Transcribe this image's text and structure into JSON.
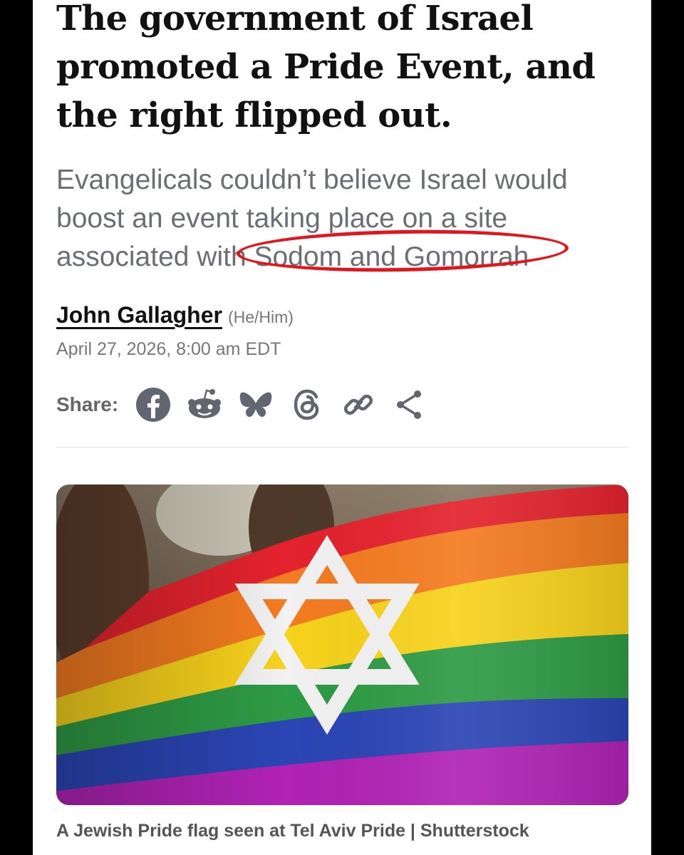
{
  "article": {
    "headline": "The government of Israel promoted a Pride Event, and the right flipped out.",
    "dek_before": "Evangelicals couldn’t believe Israel would boost an event taking place on a site associated with",
    "dek_highlight": "Sodom and Gomorrah",
    "author": "John Gallagher",
    "pronouns": "(He/Him)",
    "date": "April 27, 2026, 8:00 am EDT"
  },
  "share": {
    "label": "Share:",
    "icons": [
      "facebook-icon",
      "reddit-icon",
      "bluesky-icon",
      "threads-icon",
      "link-icon",
      "share-icon"
    ]
  },
  "image": {
    "caption": "A Jewish Pride flag seen at Tel Aviv Pride | Shutterstock",
    "colors": {
      "red": "#e4232e",
      "orange": "#f47b20",
      "yellow": "#f7d21c",
      "green": "#2e9b45",
      "blue": "#2b45b5",
      "purple": "#b023b5",
      "star": "#f2f2f2"
    }
  },
  "annotation": {
    "circle_color": "#e3141b"
  }
}
